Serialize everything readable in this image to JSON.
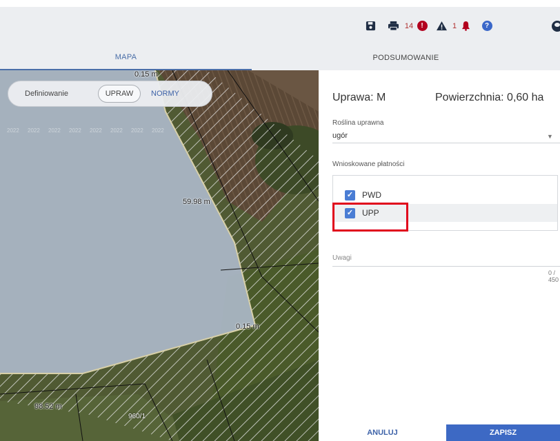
{
  "toolbar": {
    "save_icon": "floppy-save-icon",
    "print_icon": "printer-icon",
    "error_count": "14",
    "error_icon": "exclamation-circle-icon",
    "warning_icon": "warning-triangle-icon",
    "warning_count": "1",
    "bell_icon": "bell-icon",
    "help_icon": "help-circle-icon",
    "help_glyph": "?",
    "error_glyph": "!",
    "user_icon": "user-icon",
    "colors": {
      "dark": "#1f2d44",
      "alert": "#b2001e",
      "help": "#3a67c9"
    }
  },
  "tabs": [
    {
      "label": "MAPA",
      "active": true
    },
    {
      "label": "PODSUMOWANIE",
      "active": false
    }
  ],
  "map": {
    "overlay_text": "2022",
    "labels": {
      "top_measure": "0.15 m",
      "side_measure": "59.98 m",
      "right_measure": "0.15 m",
      "bottom_measure": "98.52 m",
      "parcel": "960/1"
    },
    "toggle": {
      "label": "Definiowanie",
      "option_upraw": "UPRAW",
      "option_normy": "NORMY",
      "selected": "UPRAW"
    }
  },
  "panel": {
    "title": "Uprawa: M",
    "area": "Powierzchnia: 0,60 ha",
    "crop_label": "Roślina uprawna",
    "crop_value": "ugór",
    "payments_label": "Wnioskowane płatności",
    "payments": [
      {
        "label": "PWD",
        "checked": true
      },
      {
        "label": "UPP",
        "checked": true
      }
    ],
    "notes_label": "Uwagi",
    "notes_counter": "0 / 450",
    "cancel_label": "ANULUJ",
    "save_label": "ZAPISZ",
    "accent_color": "#3d69c4",
    "highlight_color": "#e0001b"
  }
}
